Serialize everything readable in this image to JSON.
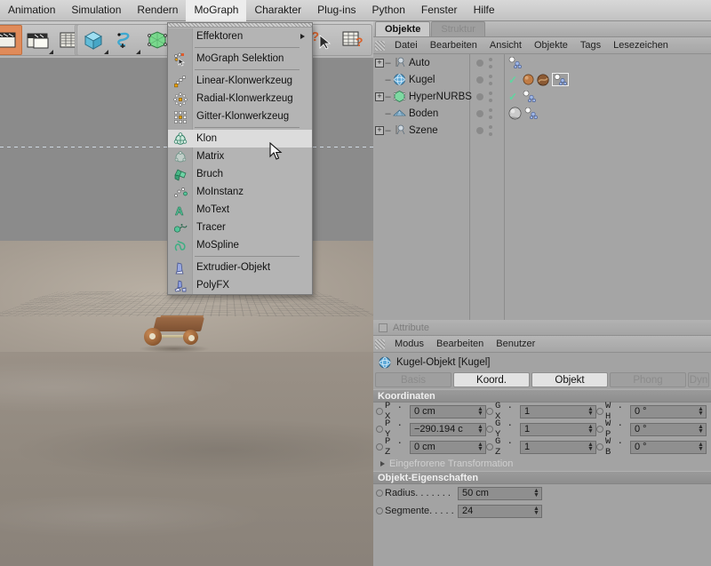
{
  "app": {
    "title": "Cinema 4D"
  },
  "menubar": {
    "items": [
      {
        "label": "Animation",
        "active": false
      },
      {
        "label": "Simulation",
        "active": false
      },
      {
        "label": "Rendern",
        "active": false
      },
      {
        "label": "MoGraph",
        "active": true
      },
      {
        "label": "Charakter",
        "active": false
      },
      {
        "label": "Plug-ins",
        "active": false
      },
      {
        "label": "Python",
        "active": false
      },
      {
        "label": "Fenster",
        "active": false
      },
      {
        "label": "Hilfe",
        "active": false
      }
    ]
  },
  "dropdown": {
    "owner": "MoGraph",
    "highlighted": "Klon",
    "items": [
      {
        "label": "Effektoren",
        "icon": "effektoren-icon",
        "submenu": true,
        "sep_after": true
      },
      {
        "label": "MoGraph Selektion",
        "icon": "mograph-selektion-icon",
        "submenu": false,
        "sep_after": true
      },
      {
        "label": "Linear-Klonwerkzeug",
        "icon": "linear-klonwerkzeug-icon",
        "submenu": false,
        "sep_after": false
      },
      {
        "label": "Radial-Klonwerkzeug",
        "icon": "radial-klonwerkzeug-icon",
        "submenu": false,
        "sep_after": false
      },
      {
        "label": "Gitter-Klonwerkzeug",
        "icon": "gitter-klonwerkzeug-icon",
        "submenu": false,
        "sep_after": true
      },
      {
        "label": "Klon",
        "icon": "klon-icon",
        "submenu": false,
        "sep_after": false
      },
      {
        "label": "Matrix",
        "icon": "matrix-icon",
        "submenu": false,
        "sep_after": false
      },
      {
        "label": "Bruch",
        "icon": "bruch-icon",
        "submenu": false,
        "sep_after": false
      },
      {
        "label": "MoInstanz",
        "icon": "moinstanz-icon",
        "submenu": false,
        "sep_after": false
      },
      {
        "label": "MoText",
        "icon": "motext-icon",
        "submenu": false,
        "sep_after": false
      },
      {
        "label": "Tracer",
        "icon": "tracer-icon",
        "submenu": false,
        "sep_after": false
      },
      {
        "label": "MoSpline",
        "icon": "mospline-icon",
        "submenu": false,
        "sep_after": true
      },
      {
        "label": "Extrudier-Objekt",
        "icon": "extrudier-objekt-icon",
        "submenu": false,
        "sep_after": false
      },
      {
        "label": "PolyFX",
        "icon": "polyfx-icon",
        "submenu": false,
        "sep_after": false
      }
    ]
  },
  "toolbar": {
    "buttons": [
      {
        "name": "render-view-button",
        "icon": "render-view-icon",
        "selected": true,
        "has_corner": false
      },
      {
        "name": "render-region-button",
        "icon": "render-region-icon",
        "selected": false,
        "has_corner": true
      },
      {
        "name": "render-settings-button",
        "icon": "render-settings-icon",
        "selected": false,
        "has_corner": false
      },
      {
        "name": "cube-primitive-button",
        "icon": "cube-icon",
        "selected": false,
        "has_corner": true
      },
      {
        "name": "spline-button",
        "icon": "spline-icon",
        "selected": false,
        "has_corner": true
      },
      {
        "name": "hypernurbs-button",
        "icon": "hypernurbs-icon",
        "selected": false,
        "has_corner": true
      },
      {
        "name": "array-button",
        "icon": "array-icon",
        "selected": false,
        "has_corner": true
      },
      {
        "name": "help-select-button",
        "icon": "help-cursor-icon",
        "selected": false,
        "has_corner": false
      },
      {
        "name": "help-table-button",
        "icon": "help-table-icon",
        "selected": false,
        "has_corner": false
      }
    ],
    "axis_buttons": [
      {
        "name": "move-axis-button",
        "icon": "move-icon"
      },
      {
        "name": "scale-axis-button",
        "icon": "scale-icon"
      },
      {
        "name": "rotate-axis-button",
        "icon": "rotate-icon"
      },
      {
        "name": "frame-button",
        "icon": "square-icon"
      }
    ]
  },
  "object_manager": {
    "tabs": [
      {
        "label": "Objekte",
        "active": true
      },
      {
        "label": "Struktur",
        "active": false
      }
    ],
    "menu": [
      "Datei",
      "Bearbeiten",
      "Ansicht",
      "Objekte",
      "Tags",
      "Lesezeichen"
    ],
    "rows": [
      {
        "name": "Auto",
        "icon": "null-object-icon",
        "expandable": true,
        "indent": 0,
        "check": false,
        "tags": [
          "mograph-tag"
        ]
      },
      {
        "name": "Kugel",
        "icon": "sphere-icon",
        "expandable": false,
        "indent": 1,
        "check": true,
        "tags": [
          "material-tag",
          "material-tag-2",
          "mograph-tag-selected"
        ]
      },
      {
        "name": "HyperNURBS",
        "icon": "hypernurbs-icon",
        "expandable": true,
        "indent": 0,
        "check": true,
        "tags": [
          "mograph-tag"
        ]
      },
      {
        "name": "Boden",
        "icon": "floor-icon",
        "expandable": false,
        "indent": 1,
        "check": false,
        "tags": [
          "material-tag-gray",
          "mograph-tag"
        ]
      },
      {
        "name": "Szene",
        "icon": "null-object-icon",
        "expandable": true,
        "indent": 0,
        "check": false,
        "tags": []
      }
    ]
  },
  "attribute_manager": {
    "title": "Attribute",
    "menu": [
      "Modus",
      "Bearbeiten",
      "Benutzer"
    ],
    "object_title": "Kugel-Objekt [Kugel]",
    "object_icon": "sphere-icon",
    "tabs": [
      {
        "label": "Basis",
        "active": false
      },
      {
        "label": "Koord.",
        "active": true
      },
      {
        "label": "Objekt",
        "active": true
      },
      {
        "label": "Phong",
        "active": false
      },
      {
        "label": "Dyn",
        "active": false
      }
    ],
    "coordinates": {
      "header": "Koordinaten",
      "rows": [
        {
          "p_label": "P . X",
          "p_value": "0 cm",
          "g_label": "G . X",
          "g_value": "1",
          "w_label": "W . H",
          "w_value": "0 °"
        },
        {
          "p_label": "P . Y",
          "p_value": "−290.194 c",
          "g_label": "G . Y",
          "g_value": "1",
          "w_label": "W . P",
          "w_value": "0 °"
        },
        {
          "p_label": "P . Z",
          "p_value": "0 cm",
          "g_label": "G . Z",
          "g_value": "1",
          "w_label": "W . B",
          "w_value": "0 °"
        }
      ],
      "disclosure": "Eingefrorene Transformation"
    },
    "object_properties": {
      "header": "Objekt-Eigenschaften",
      "rows": [
        {
          "label": "Radius. . . . . . .",
          "value": "50 cm"
        },
        {
          "label": "Segmente. . . . .",
          "value": "24"
        }
      ]
    }
  },
  "viewport": {
    "name": "perspective-viewport",
    "scene_objects": [
      "car-object",
      "ground-plane",
      "horizon-line"
    ]
  }
}
